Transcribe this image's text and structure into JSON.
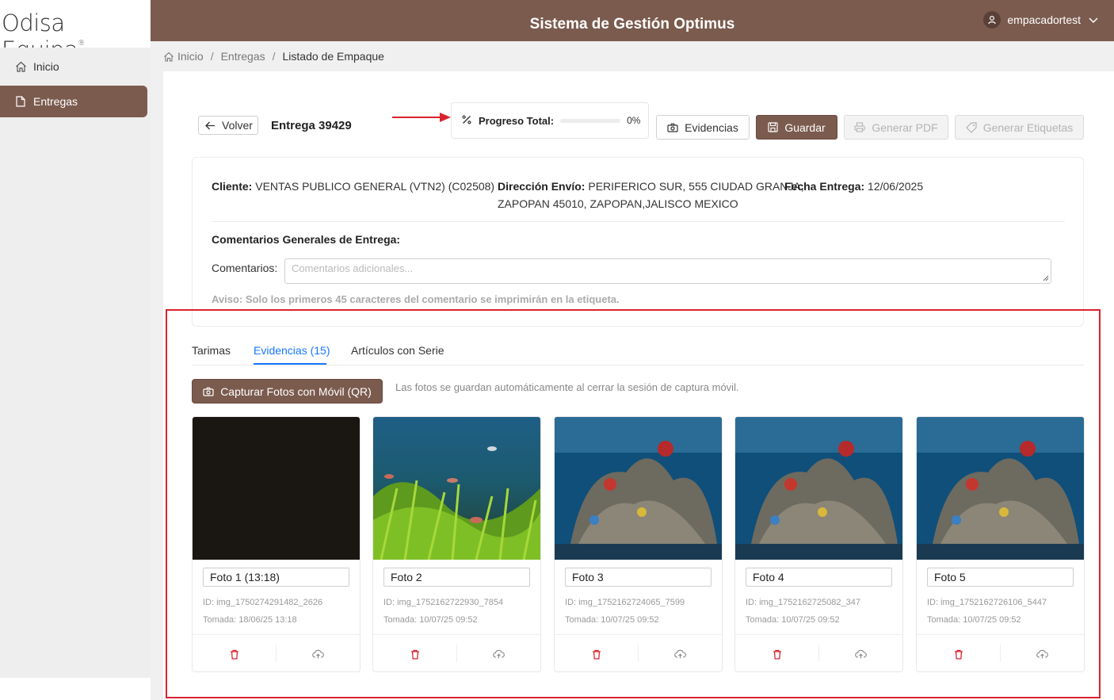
{
  "brand": {
    "logo_text": "Odisa Equipa",
    "logo_mark": "®"
  },
  "header": {
    "title": "Sistema de Gestión Optimus",
    "username": "empacadortest"
  },
  "sidebar": {
    "items": [
      {
        "label": "Inicio",
        "icon": "home-icon",
        "active": false
      },
      {
        "label": "Entregas",
        "icon": "document-icon",
        "active": true
      }
    ]
  },
  "breadcrumb": {
    "home": "Inicio",
    "section": "Entregas",
    "current": "Listado de Empaque",
    "separator": "/"
  },
  "toolbar": {
    "back_label": "Volver",
    "title": "Entrega 39429",
    "progress_label": "Progreso Total:",
    "progress_value": "0%",
    "progress_fraction": 0,
    "evidencias_label": "Evidencias",
    "guardar_label": "Guardar",
    "pdf_label": "Generar PDF",
    "etiquetas_label": "Generar Etiquetas"
  },
  "info": {
    "cliente_label": "Cliente:",
    "cliente_value": "VENTAS PUBLICO GENERAL (VTN2) (C02508)",
    "direccion_label": "Dirección Envío:",
    "direccion_value_line1": "PERIFERICO SUR, 555 CIUDAD GRANJA,",
    "direccion_value_line2": "ZAPOPAN 45010, ZAPOPAN,JALISCO MEXICO",
    "fecha_label": "Fecha Entrega:",
    "fecha_value": "12/06/2025",
    "comments_title": "Comentarios Generales de Entrega:",
    "comments_label": "Comentarios",
    "comments_placeholder": "Comentarios adicionales...",
    "warning": "Aviso: Solo los primeros 45 caracteres del comentario se imprimirán en la etiqueta."
  },
  "tabs": [
    {
      "label": "Tarimas",
      "active": false
    },
    {
      "label": "Evidencias (15)",
      "active": true
    },
    {
      "label": "Artículos con Serie",
      "active": false
    }
  ],
  "evidencias": {
    "capture_label": "Capturar Fotos con Móvil (QR)",
    "hint": "Las fotos se guardan automáticamente al cerrar la sesión de captura móvil.",
    "photos": [
      {
        "name": "Foto 1 (13:18)",
        "id": "ID: img_1750274291482_2626",
        "date": "Tomada: 18/06/25 13:18",
        "kind": "dark"
      },
      {
        "name": "Foto 2",
        "id": "ID: img_1752162722930_7854",
        "date": "Tomada: 10/07/25 09:52",
        "kind": "plants"
      },
      {
        "name": "Foto 3",
        "id": "ID: img_1752162724065_7599",
        "date": "Tomada: 10/07/25 09:52",
        "kind": "reef"
      },
      {
        "name": "Foto 4",
        "id": "ID: img_1752162725082_347",
        "date": "Tomada: 10/07/25 09:52",
        "kind": "reef"
      },
      {
        "name": "Foto 5",
        "id": "ID: img_1752162726106_5447",
        "date": "Tomada: 10/07/25 09:52",
        "kind": "reef"
      }
    ]
  },
  "colors": {
    "brand": "#7b5b4e",
    "accent": "#1677ff",
    "danger": "#d9232e",
    "highlight": "#d9232e"
  }
}
